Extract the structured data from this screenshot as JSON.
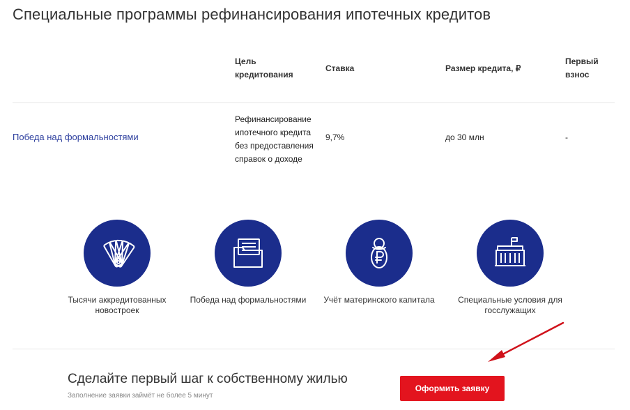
{
  "page": {
    "title": "Специальные программы рефинансирования ипотечных кредитов"
  },
  "table": {
    "headers": {
      "purpose": "Цель кредитования",
      "rate": "Ставка",
      "amount": "Размер кредита, ₽",
      "down_payment": "Первый взнос"
    },
    "rows": [
      {
        "program": "Победа над формальностями",
        "purpose": "Рефинансирование ипотечного кредита без предоставления справок о доходе",
        "rate": "9,7%",
        "amount": "до 30 млн",
        "down_payment": "-"
      }
    ]
  },
  "features": [
    {
      "icon": "fan-cards-icon",
      "label": "Тысячи аккредитованных новостроек"
    },
    {
      "icon": "folder-documents-icon",
      "label": "Победа над формальностями"
    },
    {
      "icon": "baby-ruble-icon",
      "label": "Учёт материнского капитала"
    },
    {
      "icon": "government-building-icon",
      "label": "Специальные условия для госслужащих"
    }
  ],
  "cta": {
    "title": "Сделайте первый шаг к собственному жилью",
    "subtitle": "Заполнение заявки займёт не более 5 минут",
    "button_label": "Оформить заявку"
  },
  "colors": {
    "accent_blue": "#1b2d8c",
    "link": "#2d3f9e",
    "button_red": "#e3141e",
    "arrow_red": "#d0121b"
  }
}
